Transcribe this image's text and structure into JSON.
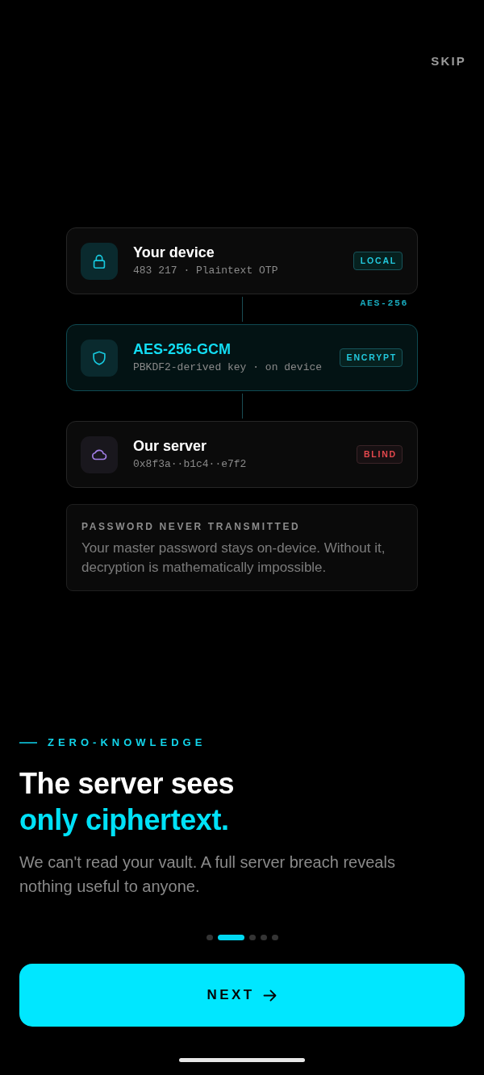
{
  "header": {
    "skip": "SKIP"
  },
  "flow": {
    "nodes": [
      {
        "kind": "client",
        "title": "Your device",
        "detail": "483 217 · Plaintext OTP",
        "badge": "LOCAL",
        "highlighted": false,
        "link_label": "AES-256"
      },
      {
        "kind": "cipher",
        "title": "AES-256-GCM",
        "detail": "PBKDF2-derived key · on device",
        "badge": "ENCRYPT",
        "highlighted": true
      },
      {
        "kind": "server",
        "title": "Our server",
        "detail": "0x8f3a··b1c4··e7f2",
        "badge": "BLIND",
        "highlighted": false
      }
    ]
  },
  "info": {
    "title": "PASSWORD NEVER TRANSMITTED",
    "body": "Your master password stays on-device. Without it, decryption is mathematically impossible."
  },
  "hero": {
    "eyebrow": "ZERO-KNOWLEDGE",
    "headline": [
      {
        "text": "The server sees",
        "accent": false
      },
      {
        "text": "only ciphertext.",
        "accent": true
      }
    ],
    "body": "We can't read your vault. A full server breach reveals nothing useful to anyone."
  },
  "pager": {
    "pages": [
      {
        "selected": false
      },
      {
        "selected": true
      },
      {
        "selected": false
      },
      {
        "selected": false
      },
      {
        "selected": false
      }
    ]
  },
  "primary_button": {
    "label": "NEXT"
  }
}
